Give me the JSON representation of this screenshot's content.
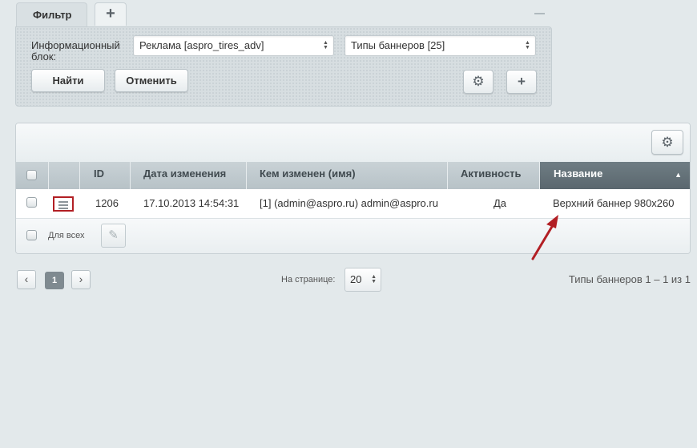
{
  "filter": {
    "tab_label": "Фильтр",
    "add_tab_icon": "plus-icon",
    "iblock_label": "Информационный блок:",
    "iblock_value": "Реклама [aspro_tires_adv]",
    "type_value": "Типы баннеров [25]",
    "find_label": "Найти",
    "cancel_label": "Отменить",
    "settings_icon": "gear-icon",
    "add_icon": "plus-icon"
  },
  "grid": {
    "settings_icon": "gear-icon",
    "columns": [
      "ID",
      "Дата изменения",
      "Кем изменен (имя)",
      "Активность",
      "Название"
    ],
    "sorted_column": "Название",
    "sort_direction": "ascending",
    "rows": [
      {
        "id": "1206",
        "date": "17.10.2013 14:54:31",
        "modified_by": "[1] (admin@aspro.ru) admin@aspro.ru",
        "active": "Да",
        "name": "Верхний баннер 980x260"
      }
    ],
    "for_all_label": "Для всех"
  },
  "pager": {
    "prev": "‹",
    "current": "1",
    "next": "›",
    "per_page_label": "На странице:",
    "per_page_value": "20",
    "total_text": "Типы баннеров 1 – 1 из 1"
  },
  "colors": {
    "annotation_arrow": "#b21f24",
    "sorted_header": "#5f6c73",
    "background": "#e3e9eb"
  }
}
